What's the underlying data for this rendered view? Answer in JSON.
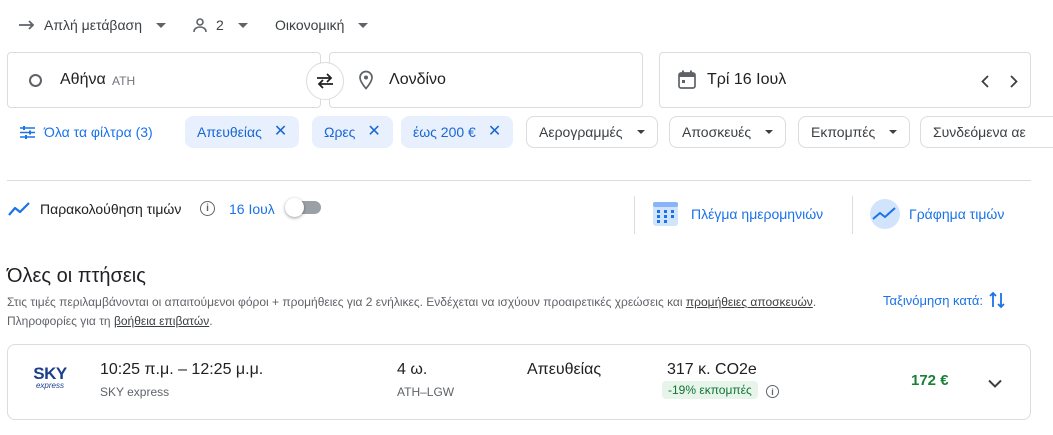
{
  "top": {
    "trip_type": "Απλή μετάβαση",
    "passengers": "2",
    "cabin_class": "Οικονομική"
  },
  "search": {
    "origin_city": "Αθήνα",
    "origin_code": "ATH",
    "destination": "Λονδίνο",
    "date": "Τρί 16 Ιουλ"
  },
  "filters": {
    "all_filters": "Όλα τα φίλτρα (3)",
    "chips_active": [
      "Απευθείας",
      "Ωρες",
      "έως 200 €"
    ],
    "chips_menu": [
      "Αερογραμμές",
      "Αποσκευές",
      "Εκπομπές",
      "Συνδεόμενα αε"
    ]
  },
  "tracking": {
    "label": "Παρακολούθηση τιμών",
    "date": "16 Ιουλ",
    "toggle_on": false,
    "date_grid": "Πλέγμα ημερομηνιών",
    "price_graph": "Γράφημα τιμών"
  },
  "results": {
    "heading": "Όλες οι πτήσεις",
    "notice_part1": "Στις τιμές περιλαμβάνονται οι απαιτούμενοι φόροι + προμήθειες για 2 ενήλικες. Ενδέχεται να ισχύουν προαιρετικές χρεώσεις και ",
    "notice_link1": "προμήθειες αποσκευών",
    "notice_part2": ". Πληροφορίες για τη ",
    "notice_link2": "βοήθεια επιβατών",
    "notice_part3": ".",
    "sort_label": "Ταξινόμηση κατά:"
  },
  "flight": {
    "airline_logo_top": "SKY",
    "airline_logo_bottom": "express",
    "times": "10:25 π.μ. – 12:25 μ.μ.",
    "airline": "SKY express",
    "duration": "4 ω.",
    "route": "ATH–LGW",
    "stops": "Απευθείας",
    "emissions": "317 κ. CO2e",
    "emissions_badge": "-19% εκπομπές",
    "price": "172 €"
  },
  "colors": {
    "accent": "#1a73e8",
    "chip_active_bg": "#e8f0fe",
    "price_green": "#188038",
    "badge_bg": "#e6f4ea"
  }
}
